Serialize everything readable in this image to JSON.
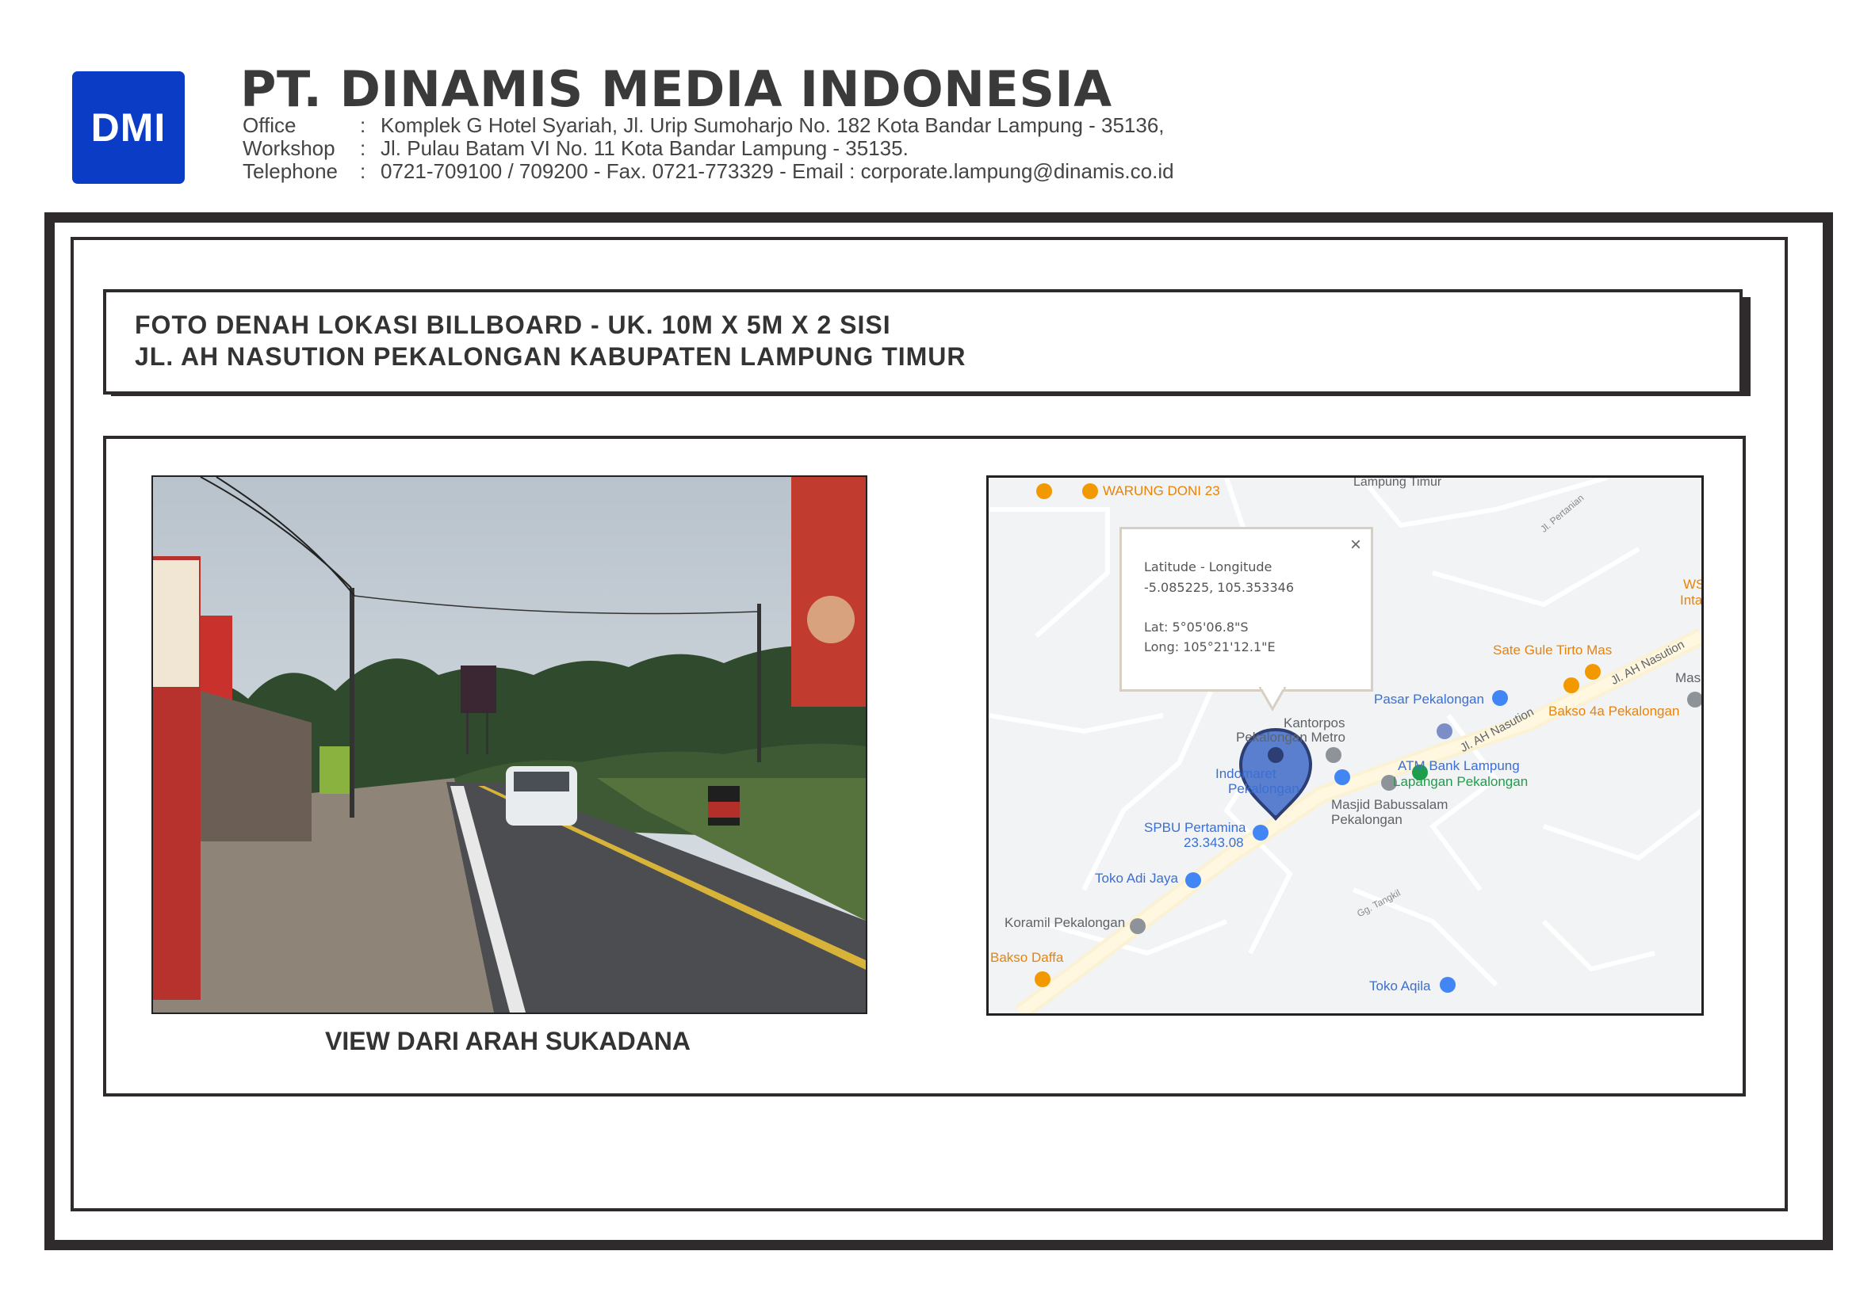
{
  "header": {
    "logo_text": "DMI",
    "company_name": "PT. DINAMIS MEDIA INDONESIA",
    "rows": [
      {
        "label": "Office",
        "sep": ":",
        "value": "Komplek G Hotel Syariah, Jl. Urip  Sumoharjo No. 182 Kota Bandar Lampung - 35136,"
      },
      {
        "label": "Workshop",
        "sep": ":",
        "value": "Jl. Pulau Batam  VI  No. 11 Kota Bandar Lampung - 35135."
      },
      {
        "label": "Telephone",
        "sep": ":",
        "value": "0721-709100 / 709200 - Fax. 0721-773329 - Email : corporate.lampung@dinamis.co.id"
      }
    ]
  },
  "title": {
    "line1": "FOTO DENAH LOKASI BILLBOARD - UK. 10M X 5M X 2 SISI",
    "line2": "JL. AH NASUTION PEKALONGAN KABUPATEN LAMPUNG TIMUR"
  },
  "photo": {
    "caption": "VIEW DARI ARAH SUKADANA"
  },
  "map": {
    "popup": {
      "line1": "Latitude - Longitude",
      "line2": "-5.085225, 105.353346",
      "line3": "Lat: 5°05'06.8\"S",
      "line4": "Long: 105°21'12.1\"E",
      "close": "×"
    },
    "labels": {
      "warung": "WARUNG DONI 23",
      "lampung_timur": "Lampung Timur",
      "jl_pertanian": "Jl. Pertanian",
      "ws": "WS",
      "inta": "Inta",
      "sate": "Sate Gule Tirto Mas",
      "jl_ah_nasution_1": "Jl. AH Nasution",
      "mas": "Mas",
      "pasar": "Pasar Pekalongan",
      "bakso4a": "Bakso 4a Pekalongan",
      "jl_ah_nasution_2": "Jl. AH Nasution",
      "kantorpos": "Kantorpos",
      "pek_metro": "Pekalongan Metro",
      "atm": "ATM Bank Lampung",
      "indomaret_1": "Indomaret",
      "indomaret_2": "Pekalongan",
      "lapangan": "Lapangan Pekalongan",
      "masjid_1": "Masjid Babussalam",
      "masjid_2": "Pekalongan",
      "spbu_1": "SPBU Pertamina",
      "spbu_2": "23.343.08",
      "toko_adi": "Toko Adi Jaya",
      "gg_tangkil": "Gg. Tangkil",
      "koramil": "Koramil Pekalongan",
      "bakso_daffa": "Bakso Daffa",
      "toko_aqila": "Toko Aqila"
    }
  }
}
